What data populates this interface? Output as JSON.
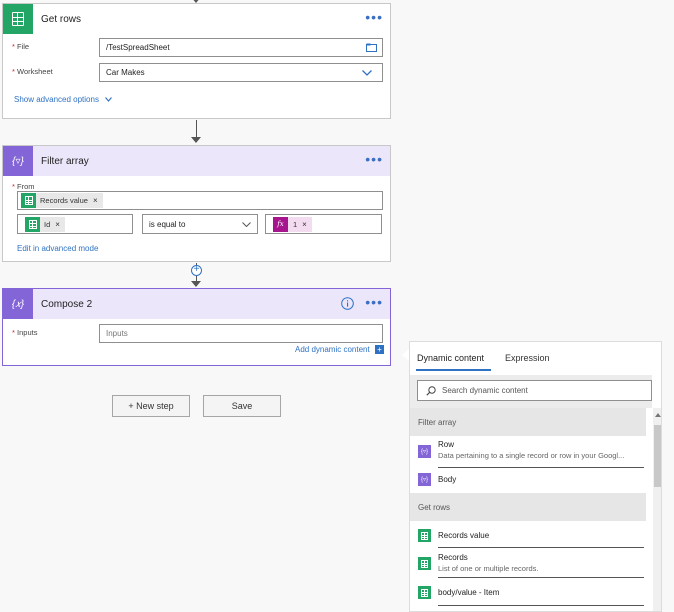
{
  "get_rows": {
    "title": "Get rows",
    "file_label": "File",
    "file_value": "/TestSpreadSheet",
    "worksheet_label": "Worksheet",
    "worksheet_value": "Car Makes",
    "advanced_link": "Show advanced options"
  },
  "filter_array": {
    "title": "Filter array",
    "from_label": "From",
    "from_token": "Records value",
    "left_token": "Id",
    "operator": "is equal to",
    "right_token": "1",
    "fx_label": "fx",
    "advanced_link": "Edit in advanced mode"
  },
  "compose": {
    "title": "Compose 2",
    "inputs_label": "Inputs",
    "inputs_placeholder": "Inputs",
    "add_dynamic_link": "Add dynamic content"
  },
  "buttons": {
    "new_step": "+ New step",
    "save": "Save"
  },
  "panel": {
    "tab_dynamic": "Dynamic content",
    "tab_expression": "Expression",
    "search_placeholder": "Search dynamic content",
    "sections": [
      {
        "header": "Filter array",
        "items": [
          {
            "title": "Row",
            "desc": "Data pertaining to a single record or row in your Googl..."
          },
          {
            "title": "Body",
            "desc": ""
          }
        ]
      },
      {
        "header": "Get rows",
        "items": [
          {
            "title": "Records value",
            "desc": ""
          },
          {
            "title": "Records",
            "desc": "List of one or multiple records."
          },
          {
            "title": "body/value - Item",
            "desc": ""
          }
        ]
      }
    ]
  },
  "icons": {
    "sheets": "google-sheets-icon",
    "filter": "filter-array-icon",
    "compose": "compose-icon"
  },
  "colors": {
    "sheets_green": "#23a566",
    "action_purple": "#8365d7",
    "link_blue": "#2f72c4"
  }
}
